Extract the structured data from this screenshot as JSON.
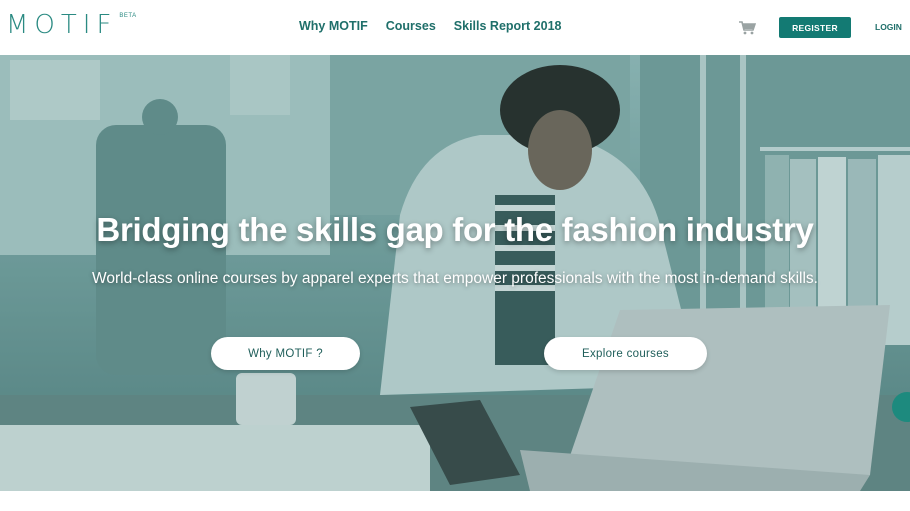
{
  "header": {
    "logo": {
      "text": "MOTIF",
      "badge": "BETA"
    },
    "nav": [
      {
        "label": "Why MOTIF"
      },
      {
        "label": "Courses"
      },
      {
        "label": "Skills Report 2018"
      }
    ],
    "cart_icon": "shopping-cart-icon",
    "register_label": "REGISTER",
    "login_label": "LOGIN"
  },
  "hero": {
    "title": "Bridging the skills gap for the fashion industry",
    "subtitle": "World-class online courses by apparel experts that empower professionals with the most in-demand skills.",
    "buttons": [
      {
        "label": "Why MOTIF ?"
      },
      {
        "label": "Explore courses"
      }
    ],
    "image_description_icon": "hero-photo-woman-laptop"
  },
  "colors": {
    "brand": "#137a73",
    "nav_text": "#1f6f6a",
    "hero_tint": "#7fa9a7",
    "white": "#ffffff"
  }
}
